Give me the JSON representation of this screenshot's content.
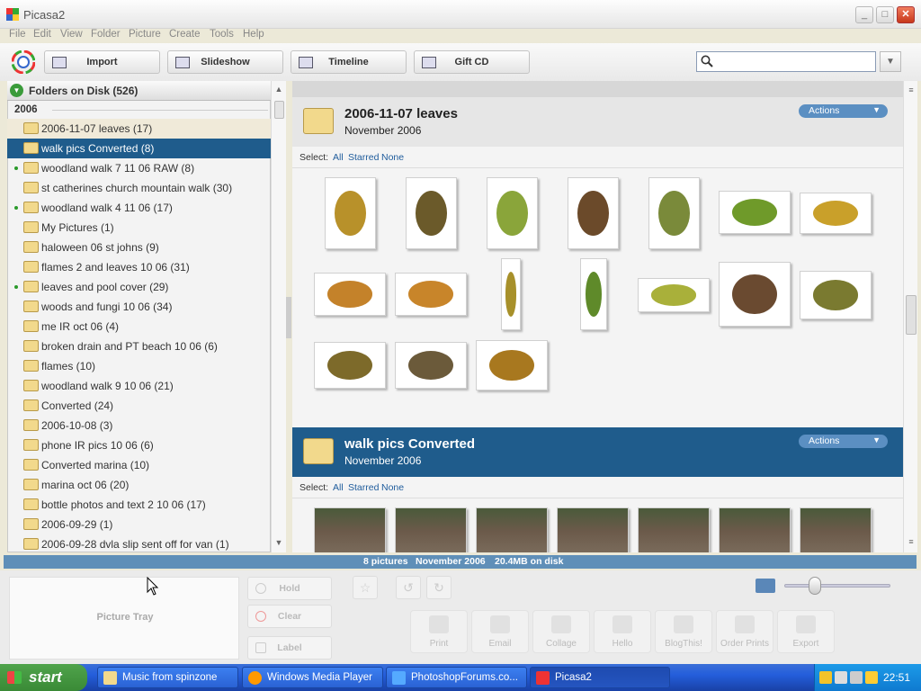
{
  "window": {
    "title": "Picasa2"
  },
  "menu": [
    "File",
    "Edit",
    "View",
    "Folder",
    "Picture",
    "Create",
    "Tools",
    "Help"
  ],
  "toolbar": {
    "import": "Import",
    "slideshow": "Slideshow",
    "timeline": "Timeline",
    "giftcd": "Gift CD",
    "search_value": ""
  },
  "folders": {
    "header": "Folders on Disk (526)",
    "year": "2006",
    "items": [
      {
        "label": "2006-11-07 leaves (17)"
      },
      {
        "label": "walk pics Converted (8)"
      },
      {
        "label": "woodland walk 7 11 06  RAW (8)"
      },
      {
        "label": "st catherines church mountain walk (30)"
      },
      {
        "label": "woodland walk 4 11 06 (17)"
      },
      {
        "label": "My Pictures (1)"
      },
      {
        "label": "haloween 06 st johns (9)"
      },
      {
        "label": "flames 2 and leaves 10 06 (31)"
      },
      {
        "label": "leaves and pool cover (29)"
      },
      {
        "label": "woods and fungi 10 06 (34)"
      },
      {
        "label": "me IR oct 06 (4)"
      },
      {
        "label": "broken drain and PT beach 10 06 (6)"
      },
      {
        "label": "flames (10)"
      },
      {
        "label": "woodland walk 9 10 06 (21)"
      },
      {
        "label": "Converted (24)"
      },
      {
        "label": "2006-10-08 (3)"
      },
      {
        "label": "phone IR pics 10 06 (6)"
      },
      {
        "label": "Converted marina (10)"
      },
      {
        "label": "marina oct 06 (20)"
      },
      {
        "label": "bottle photos and text 2 10 06 (17)"
      },
      {
        "label": "2006-09-29 (1)"
      },
      {
        "label": "2006-09-28      dvla slip sent off for van (1)"
      }
    ]
  },
  "albums": [
    {
      "title": "2006-11-07 leaves",
      "date": "November 2006",
      "actions": "Actions",
      "select_label": "Select:",
      "select_all": "All",
      "select_starred": "Starred",
      "select_none": "None"
    },
    {
      "title": "walk pics Converted",
      "date": "November 2006",
      "actions": "Actions",
      "select_label": "Select:",
      "select_all": "All",
      "select_starred": "Starred",
      "select_none": "None"
    }
  ],
  "status": {
    "count": "8 pictures",
    "date": "November 2006",
    "size": "20.4MB on disk"
  },
  "tray": {
    "picture_tray": "Picture Tray",
    "hold": "Hold",
    "clear": "Clear",
    "label": "Label",
    "actions": [
      "Print",
      "Email",
      "Collage",
      "Hello",
      "BlogThis!",
      "Order Prints",
      "Export"
    ]
  },
  "taskbar": {
    "start": "start",
    "tasks": [
      "Music from spinzone",
      "Windows Media Player",
      "PhotoshopForums.co...",
      "Picasa2"
    ],
    "clock": "22:51"
  },
  "colors": {
    "selection": "#1f5c8c",
    "status_bar": "#5f8fb8",
    "taskbar": "#245edb",
    "start": "#3a8a36"
  }
}
